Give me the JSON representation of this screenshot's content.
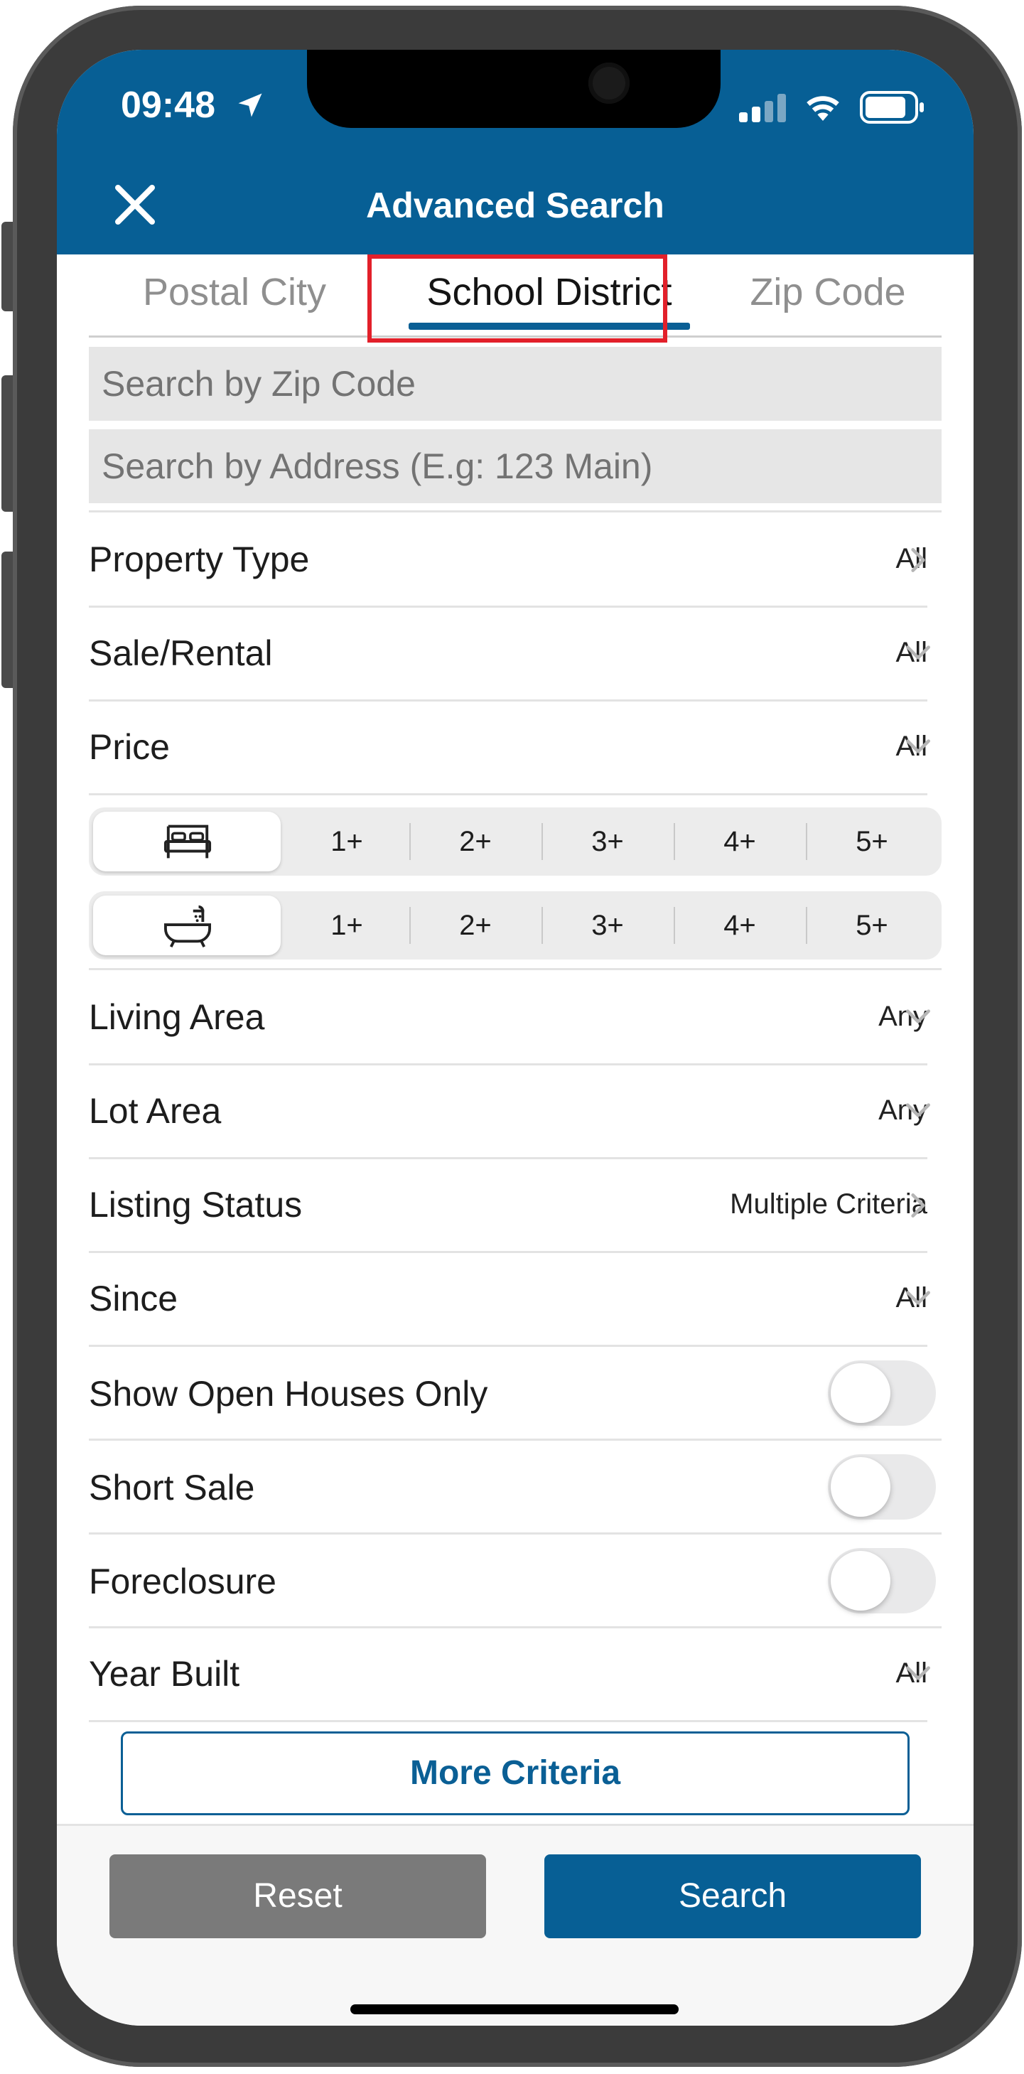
{
  "status_bar": {
    "time": "09:48"
  },
  "header": {
    "title": "Advanced Search"
  },
  "tabs": [
    {
      "label": "Postal City",
      "active": false
    },
    {
      "label": "School District",
      "active": true
    },
    {
      "label": "Zip Code",
      "active": false
    }
  ],
  "search": {
    "zip_placeholder": "Search by Zip Code",
    "address_placeholder": "Search by Address (E.g: 123 Main)"
  },
  "rows_top": [
    {
      "label": "Property Type",
      "value": "All",
      "chevron": "chevron-right"
    },
    {
      "label": "Sale/Rental",
      "value": "All",
      "chevron": "chevron-down"
    },
    {
      "label": "Price",
      "value": "All",
      "chevron": "chevron-down"
    }
  ],
  "beds": {
    "icon": "bed-icon",
    "options": [
      "1+",
      "2+",
      "3+",
      "4+",
      "5+"
    ]
  },
  "baths": {
    "icon": "bathtub-icon",
    "options": [
      "1+",
      "2+",
      "3+",
      "4+",
      "5+"
    ]
  },
  "rows_mid": [
    {
      "label": "Living Area",
      "value": "Any",
      "chevron": "chevron-down"
    },
    {
      "label": "Lot Area",
      "value": "Any",
      "chevron": "chevron-down"
    },
    {
      "label": "Listing Status",
      "value": "Multiple Criteria",
      "chevron": "chevron-right"
    },
    {
      "label": "Since",
      "value": "All",
      "chevron": "chevron-down"
    }
  ],
  "toggles": [
    {
      "label": "Show Open Houses Only",
      "on": false
    },
    {
      "label": "Short Sale",
      "on": false
    },
    {
      "label": "Foreclosure",
      "on": false
    }
  ],
  "year_built": {
    "label": "Year Built",
    "value": "All",
    "chevron": "chevron-down"
  },
  "more_criteria": "More Criteria",
  "footer": {
    "reset": "Reset",
    "search": "Search"
  },
  "colors": {
    "brand": "#075f95",
    "highlight": "#e2202a",
    "reset_bg": "#7a7a7a"
  }
}
